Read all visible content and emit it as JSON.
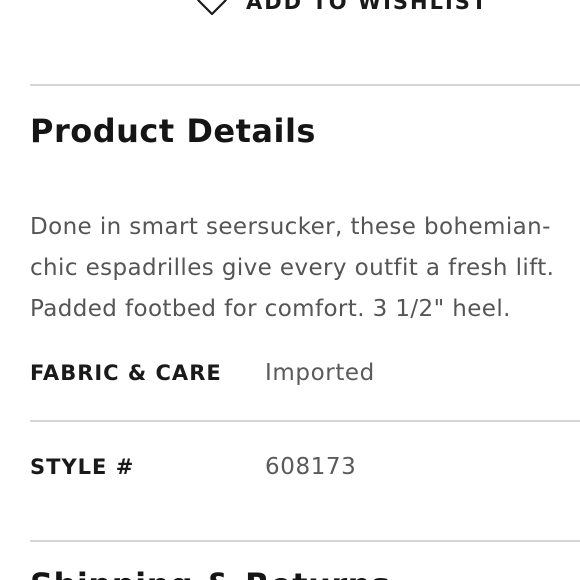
{
  "wishlist": {
    "label": "ADD TO WISHLIST",
    "icon": "heart-icon"
  },
  "product_details": {
    "title": "Product Details",
    "description_lines": [
      "Done in smart seersucker, these bohemian-",
      "chic espadrilles give every outfit a fresh lift.",
      "Padded footbed for comfort. 3 1/2\" heel."
    ],
    "specs": [
      {
        "label": "FABRIC & CARE",
        "value": "Imported"
      },
      {
        "label": "STYLE #",
        "value": "608173"
      }
    ]
  },
  "next_section": {
    "title": "Shipping & Returns"
  },
  "colors": {
    "text_dark": "#1a1a1a",
    "text_muted": "#555555",
    "divider": "#d6d6d6"
  }
}
